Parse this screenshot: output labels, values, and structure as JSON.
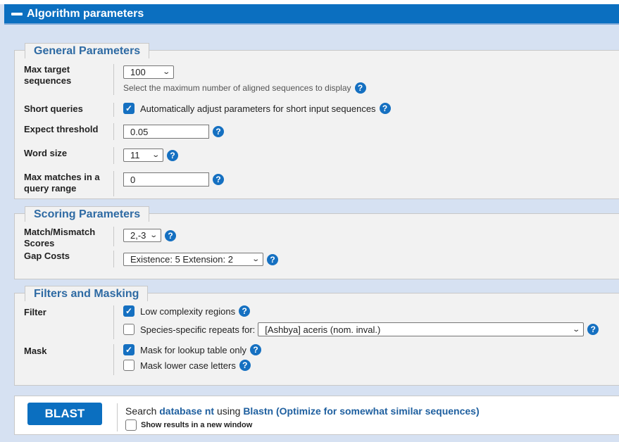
{
  "header": {
    "title": "Algorithm parameters"
  },
  "general": {
    "legend": "General Parameters",
    "max_target": {
      "label": "Max target sequences",
      "value": "100",
      "hint": "Select the maximum number of aligned sequences to display"
    },
    "short_queries": {
      "label": "Short queries",
      "checked": true,
      "text": "Automatically adjust parameters for short input sequences"
    },
    "expect": {
      "label": "Expect threshold",
      "value": "0.05"
    },
    "word_size": {
      "label": "Word size",
      "value": "11"
    },
    "max_matches": {
      "label": "Max matches in a query range",
      "value": "0"
    }
  },
  "scoring": {
    "legend": "Scoring Parameters",
    "match": {
      "label": "Match/Mismatch Scores",
      "value": "2,-3"
    },
    "gap": {
      "label": "Gap Costs",
      "value": "Existence: 5 Extension: 2"
    }
  },
  "filters": {
    "legend": "Filters and Masking",
    "filter_label": "Filter",
    "low_complexity": {
      "checked": true,
      "text": "Low complexity regions"
    },
    "species": {
      "checked": false,
      "text": "Species-specific repeats for:",
      "value": "[Ashbya] aceris (nom. inval.)"
    },
    "mask_label": "Mask",
    "lookup": {
      "checked": true,
      "text": "Mask for lookup table only"
    },
    "lowercase": {
      "checked": false,
      "text": "Mask lower case letters"
    }
  },
  "blast": {
    "button": "BLAST",
    "search_prefix": "Search",
    "database": "database nt",
    "using": "using",
    "program": "Blastn (Optimize for somewhat similar sequences)",
    "new_window": {
      "checked": false,
      "text": "Show results in a new window"
    }
  },
  "icons": {
    "help": "?",
    "check": "✓",
    "chevron": "⌄"
  },
  "colors": {
    "header": "#0b6fc0",
    "legend_text": "#2e6aa3",
    "help_icon": "#1570c1"
  }
}
